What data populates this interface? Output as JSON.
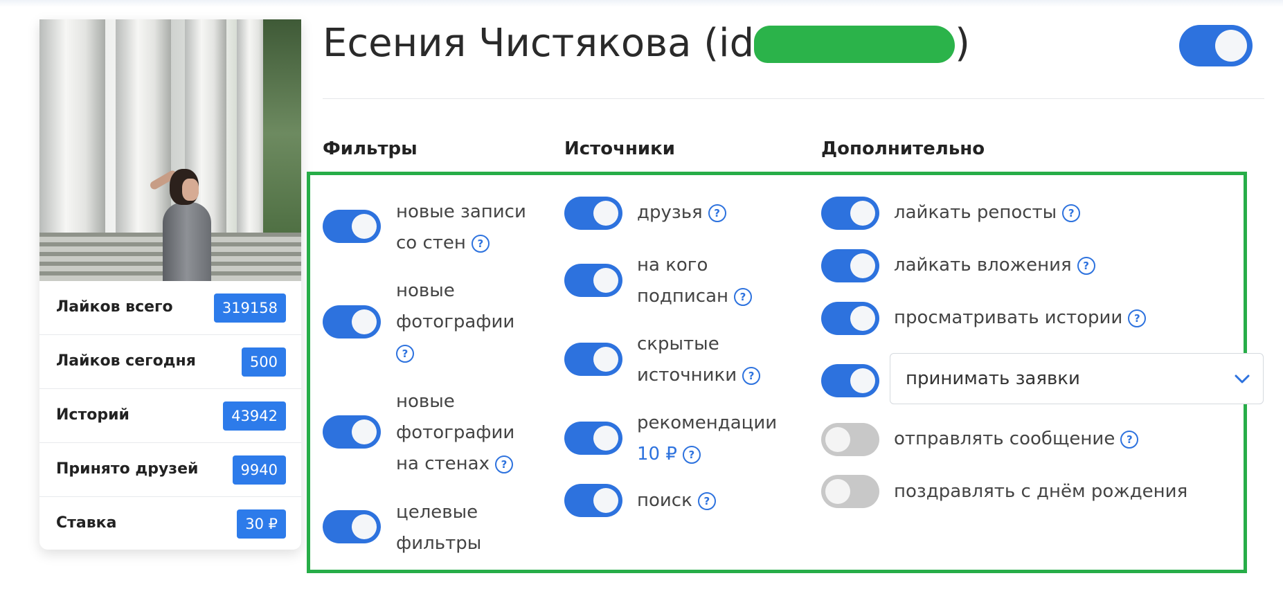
{
  "profile": {
    "name_prefix": "Есения Чистякова (id",
    "name_suffix": ")",
    "stats": [
      {
        "label": "Лайков всего",
        "value": "319158"
      },
      {
        "label": "Лайков сегодня",
        "value": "500"
      },
      {
        "label": "Историй",
        "value": "43942"
      },
      {
        "label": "Принято друзей",
        "value": "9940"
      },
      {
        "label": "Ставка",
        "value": "30 ₽"
      }
    ],
    "active": true
  },
  "sections": {
    "filters": {
      "title": "Фильтры",
      "items": [
        {
          "line1": "новые записи",
          "line2": "со стен",
          "on": true
        },
        {
          "line1": "новые",
          "line2": "фотографии",
          "on": true
        },
        {
          "line1": "новые",
          "line2": "фотографии",
          "line3": "на стенах",
          "on": true
        },
        {
          "line1": "целевые",
          "line2": "фильтры",
          "on": true
        }
      ]
    },
    "sources": {
      "title": "Источники",
      "items": [
        {
          "line1": "друзья",
          "on": true
        },
        {
          "line1": "на кого",
          "line2": "подписан",
          "on": true
        },
        {
          "line1": "скрытые",
          "line2": "источники",
          "on": true
        },
        {
          "line1": "рекомендации",
          "price": "10 ₽",
          "on": true
        },
        {
          "line1": "поиск",
          "on": true
        }
      ]
    },
    "extra": {
      "title": "Дополнительно",
      "items": [
        {
          "label": "лайкать репосты",
          "on": true
        },
        {
          "label": "лайкать вложения",
          "on": true
        },
        {
          "label": "просматривать истории",
          "on": true
        },
        {
          "label": "отправлять сообщение",
          "on": false
        },
        {
          "label": "поздравлять с днём рождения",
          "on": false
        }
      ],
      "requests_select": {
        "value": "принимать заявки",
        "on": true
      }
    }
  },
  "help_icon": "question-circle-icon",
  "colors": {
    "accent": "#2d72de",
    "highlight_box": "#27ad48",
    "toggle_off": "#c8c8c8"
  }
}
